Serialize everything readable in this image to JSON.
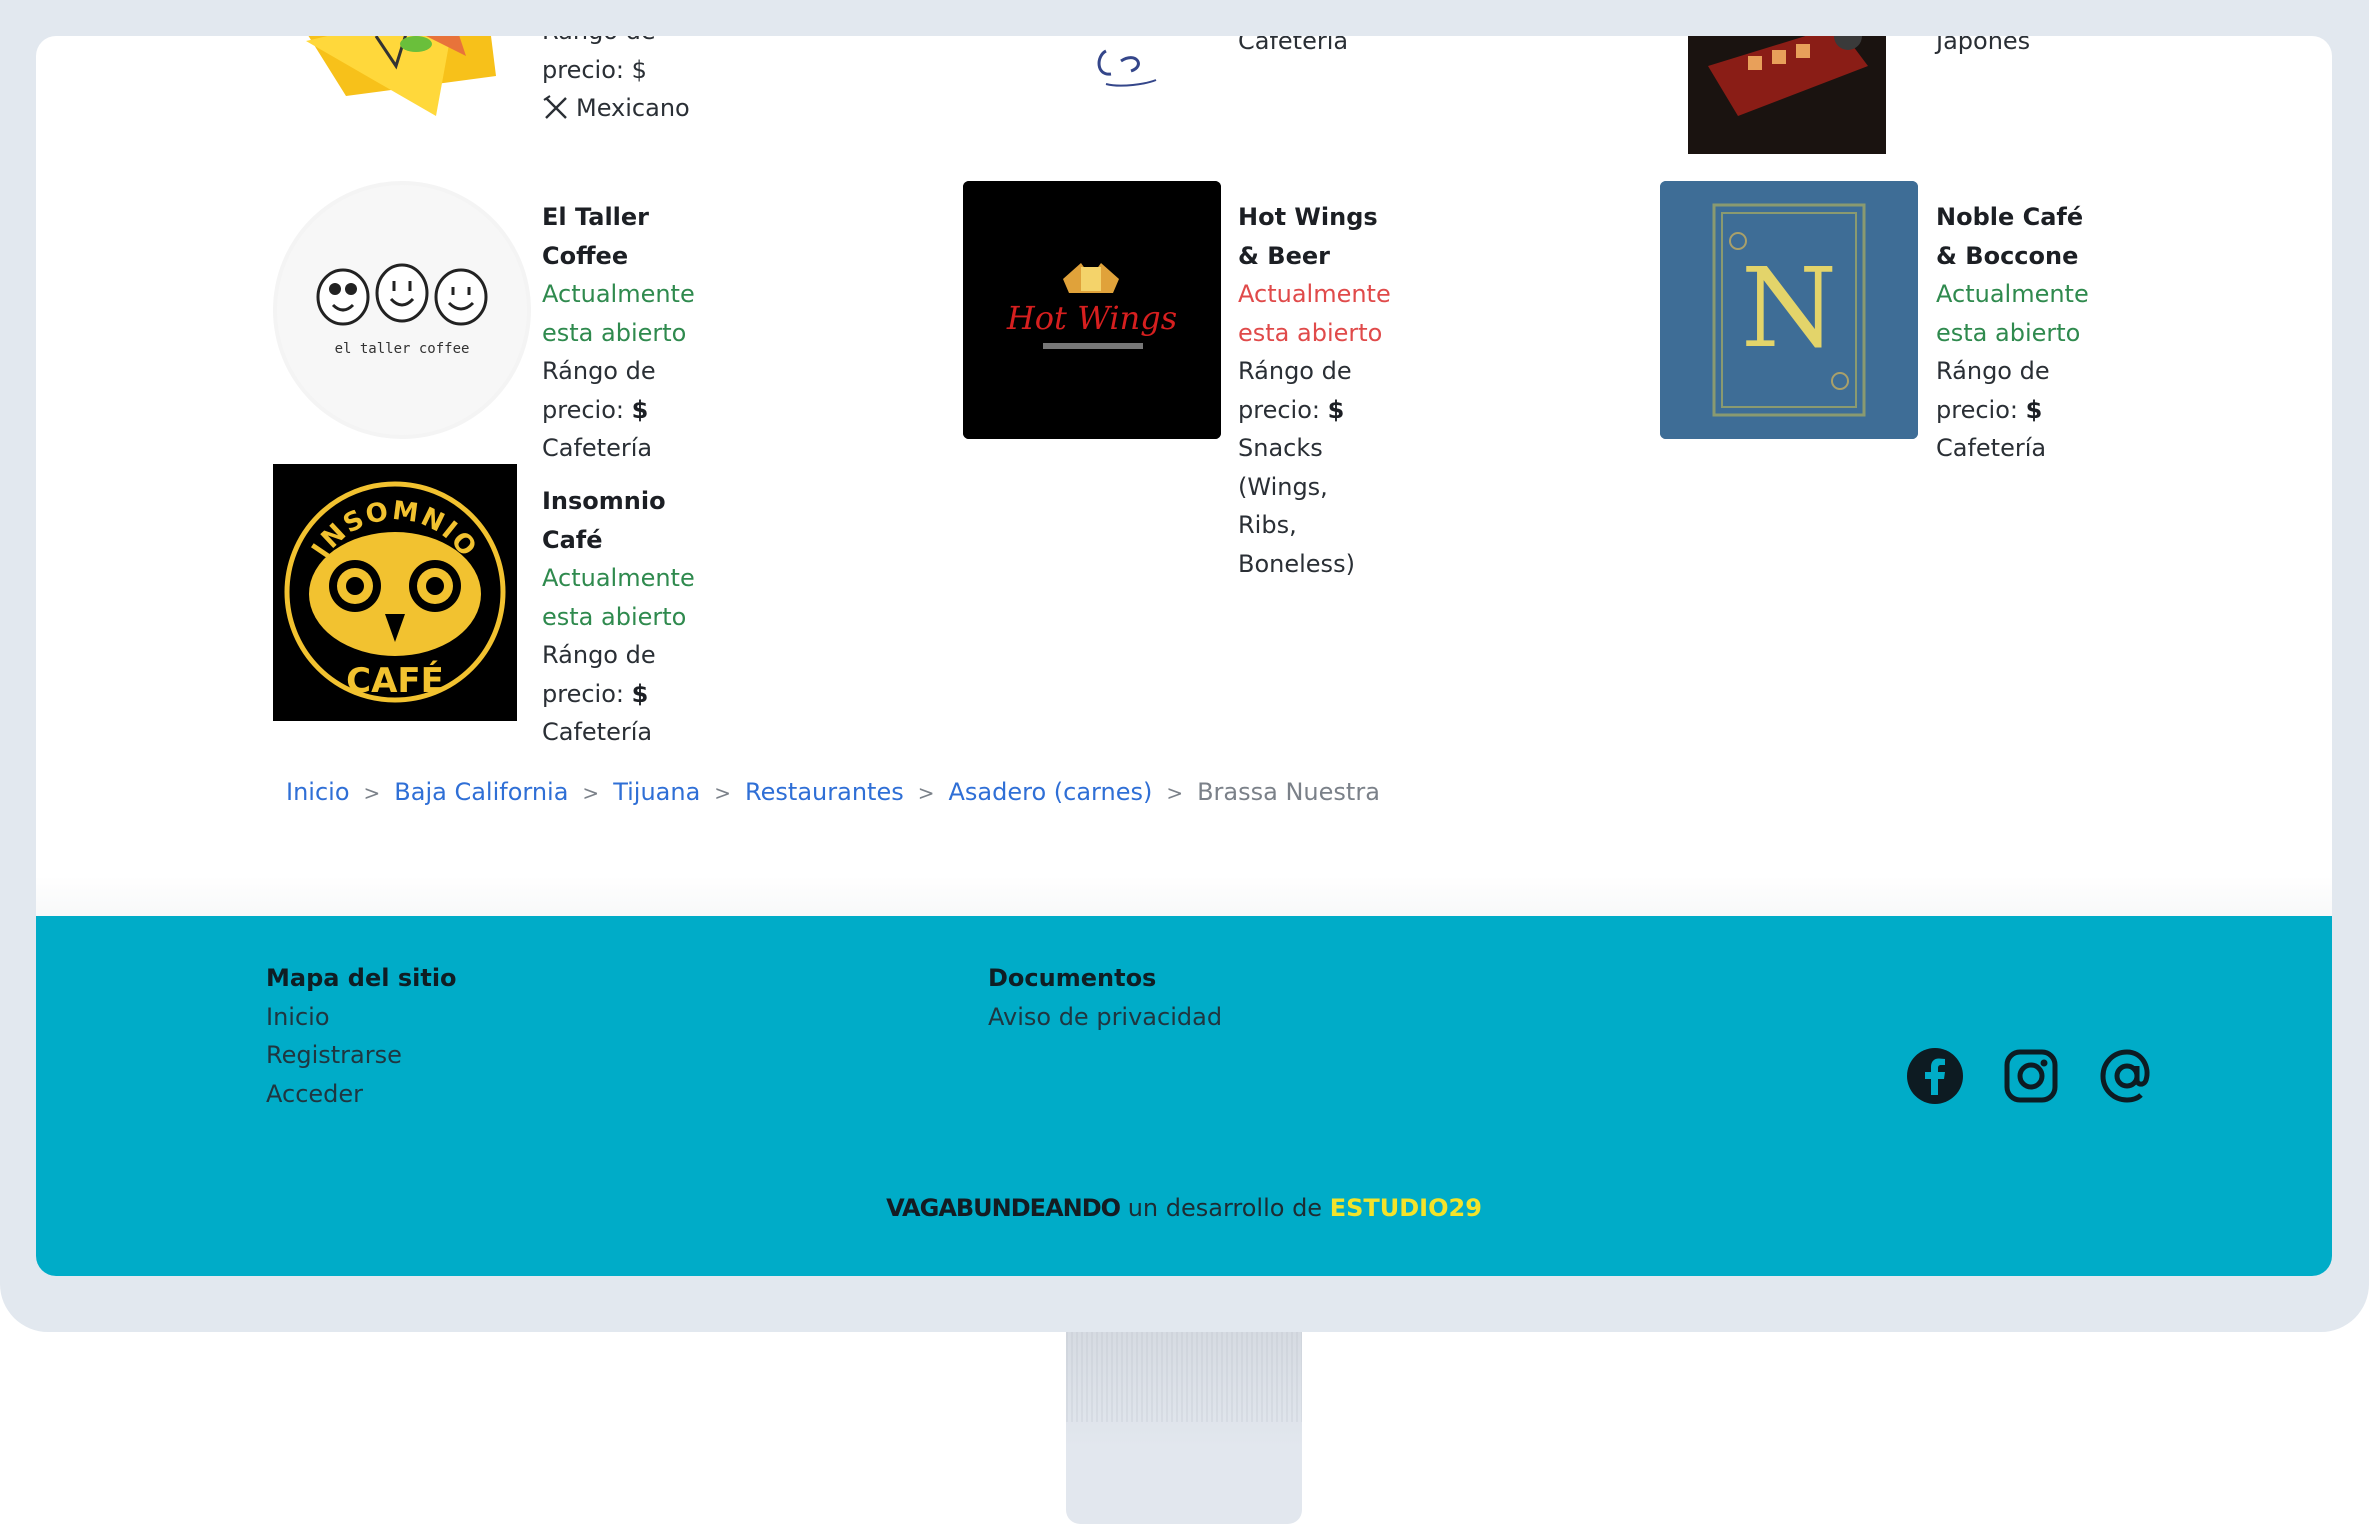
{
  "listings": {
    "top_partial": {
      "col1_text_partial": "Rango de precio: $",
      "col1_cuisine": "Mexicano",
      "col2_cuisine_partial": "Cafetería",
      "col3_cuisine_partial": "Japonés"
    },
    "items": [
      {
        "name": "El Taller Coffee",
        "status": "Actualmente esta abierto",
        "price_label": "Rángo de precio: ",
        "price_value": "$",
        "category": "Cafetería",
        "logo_text": "el taller coffee"
      },
      {
        "name": "Hot Wings & Beer",
        "status": "Actualmente esta abierto",
        "price_label": "Rángo de precio: ",
        "price_value": "$",
        "category": "Snacks (Wings, Ribs,",
        "category2": "Boneless)",
        "logo_text": "Hot Wings"
      },
      {
        "name": "Noble Café & Boccone",
        "status": "Actualmente esta abierto",
        "price_label": "Rángo de precio: ",
        "price_value": "$",
        "category": "Cafetería",
        "logo_text": "N"
      },
      {
        "name": "Insomnio Café",
        "status": "Actualmente esta abierto",
        "price_label": "Rángo de precio: ",
        "price_value": "$",
        "category": "Cafetería",
        "logo_top": "INSOMNIO",
        "logo_bottom": "CAFÉ"
      }
    ]
  },
  "breadcrumb": {
    "items": [
      "Inicio",
      "Baja California",
      "Tijuana",
      "Restaurantes",
      "Asadero (carnes)"
    ],
    "current": "Brassa Nuestra",
    "separator": ">"
  },
  "footer": {
    "sitemap": {
      "title": "Mapa del sitio",
      "links": [
        "Inicio",
        "Registrarse",
        "Acceder"
      ]
    },
    "documents": {
      "title": "Documentos",
      "links": [
        "Aviso de privacidad"
      ]
    },
    "social": [
      "facebook-icon",
      "instagram-icon",
      "email-at-icon"
    ],
    "credit": {
      "brand": "VAGABUNDEANDO",
      "middle": " un desarrollo de ",
      "studio": "ESTUDIO29"
    },
    "colors": {
      "bg": "#00acc8",
      "studio": "#f3e32a"
    }
  },
  "colors": {
    "open": "#2f8a4e",
    "closed_status": "#e04a4a",
    "link": "#2f6fd6"
  }
}
